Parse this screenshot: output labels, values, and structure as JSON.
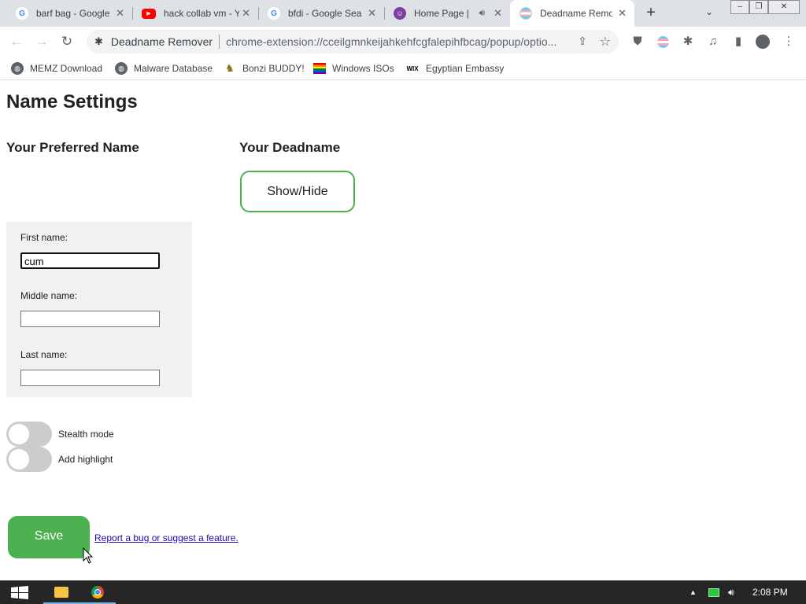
{
  "browser": {
    "tabs": [
      {
        "title": "barf bag - Google",
        "favicon": "google-g-icon",
        "active": false
      },
      {
        "title": "hack collab vm - Y",
        "favicon": "youtube-icon",
        "active": false
      },
      {
        "title": "bfdi - Google Sea",
        "favicon": "google-g-icon",
        "active": false
      },
      {
        "title": "Home Page |",
        "favicon": "bonzi-icon",
        "active": false,
        "audio": true
      },
      {
        "title": "Deadname Remo",
        "favicon": "trans-flag-icon",
        "active": true
      }
    ],
    "new_tab": "+",
    "tab_search": "⌄",
    "window_controls": [
      "–",
      "❐",
      "✕"
    ],
    "omnibox": {
      "ext_name": "Deadname Remover",
      "url": "chrome-extension://cceilgmnkeijahkehfcgfalepihfbcag/popup/optio..."
    },
    "bookmarks": [
      {
        "label": "MEMZ Download",
        "icon": "globe-icon"
      },
      {
        "label": "Malware Database",
        "icon": "globe-icon"
      },
      {
        "label": "Bonzi BUDDY!",
        "icon": "bonzi-icon"
      },
      {
        "label": "Windows ISOs",
        "icon": "rainbow-flag-icon"
      },
      {
        "label": "Egyptian Embassy",
        "icon": "wix-icon"
      }
    ]
  },
  "page": {
    "title": "Name Settings",
    "preferred_heading": "Your Preferred Name",
    "deadname_heading": "Your Deadname",
    "show_hide_label": "Show/Hide",
    "fields": {
      "first_label": "First name:",
      "first_value": "cum",
      "middle_label": "Middle name:",
      "middle_value": "",
      "last_label": "Last name:",
      "last_value": ""
    },
    "toggles": {
      "stealth_label": "Stealth mode",
      "stealth_on": false,
      "highlight_label": "Add highlight",
      "highlight_on": false
    },
    "save_label": "Save",
    "report_link": "Report a bug or suggest a feature."
  },
  "taskbar": {
    "time": "2:08 PM"
  },
  "colors": {
    "accent_green": "#4caf50",
    "tab_strip": "#dee1e6",
    "taskbar": "#262626"
  }
}
